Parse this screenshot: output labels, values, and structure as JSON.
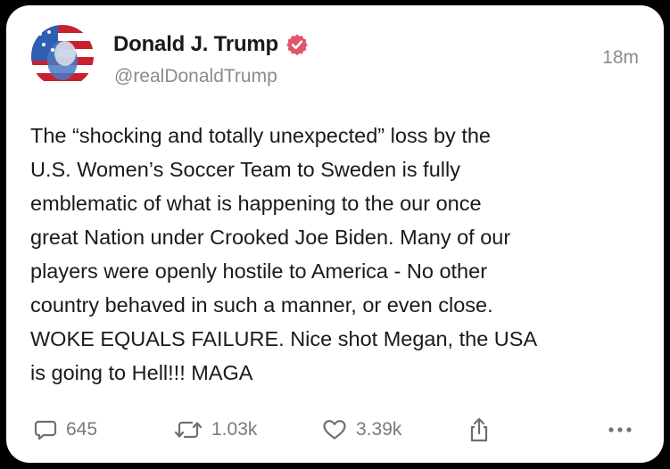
{
  "post": {
    "author": {
      "display_name": "Donald J. Trump",
      "handle": "@realDonaldTrump",
      "verified": true,
      "badge_color": "#e0566b"
    },
    "timestamp": "18m",
    "text": "The “shocking and totally unexpected” loss by the\nU.S. Women’s Soccer Team to Sweden is fully\nemblematic of what is happening to the our once\ngreat Nation under Crooked Joe Biden. Many of our\nplayers were openly hostile to America - No other\ncountry behaved in such a manner, or even close.\nWOKE EQUALS FAILURE. Nice shot Megan, the USA\nis going to Hell!!! MAGA",
    "actions": {
      "replies": "645",
      "reposts": "1.03k",
      "likes": "3.39k"
    }
  },
  "icons": {
    "reply": "speech-bubble-icon",
    "repost": "repost-arrows-icon",
    "like": "heart-icon",
    "share": "share-upload-icon",
    "more": "ellipsis-icon",
    "verified": "verified-badge-icon"
  }
}
